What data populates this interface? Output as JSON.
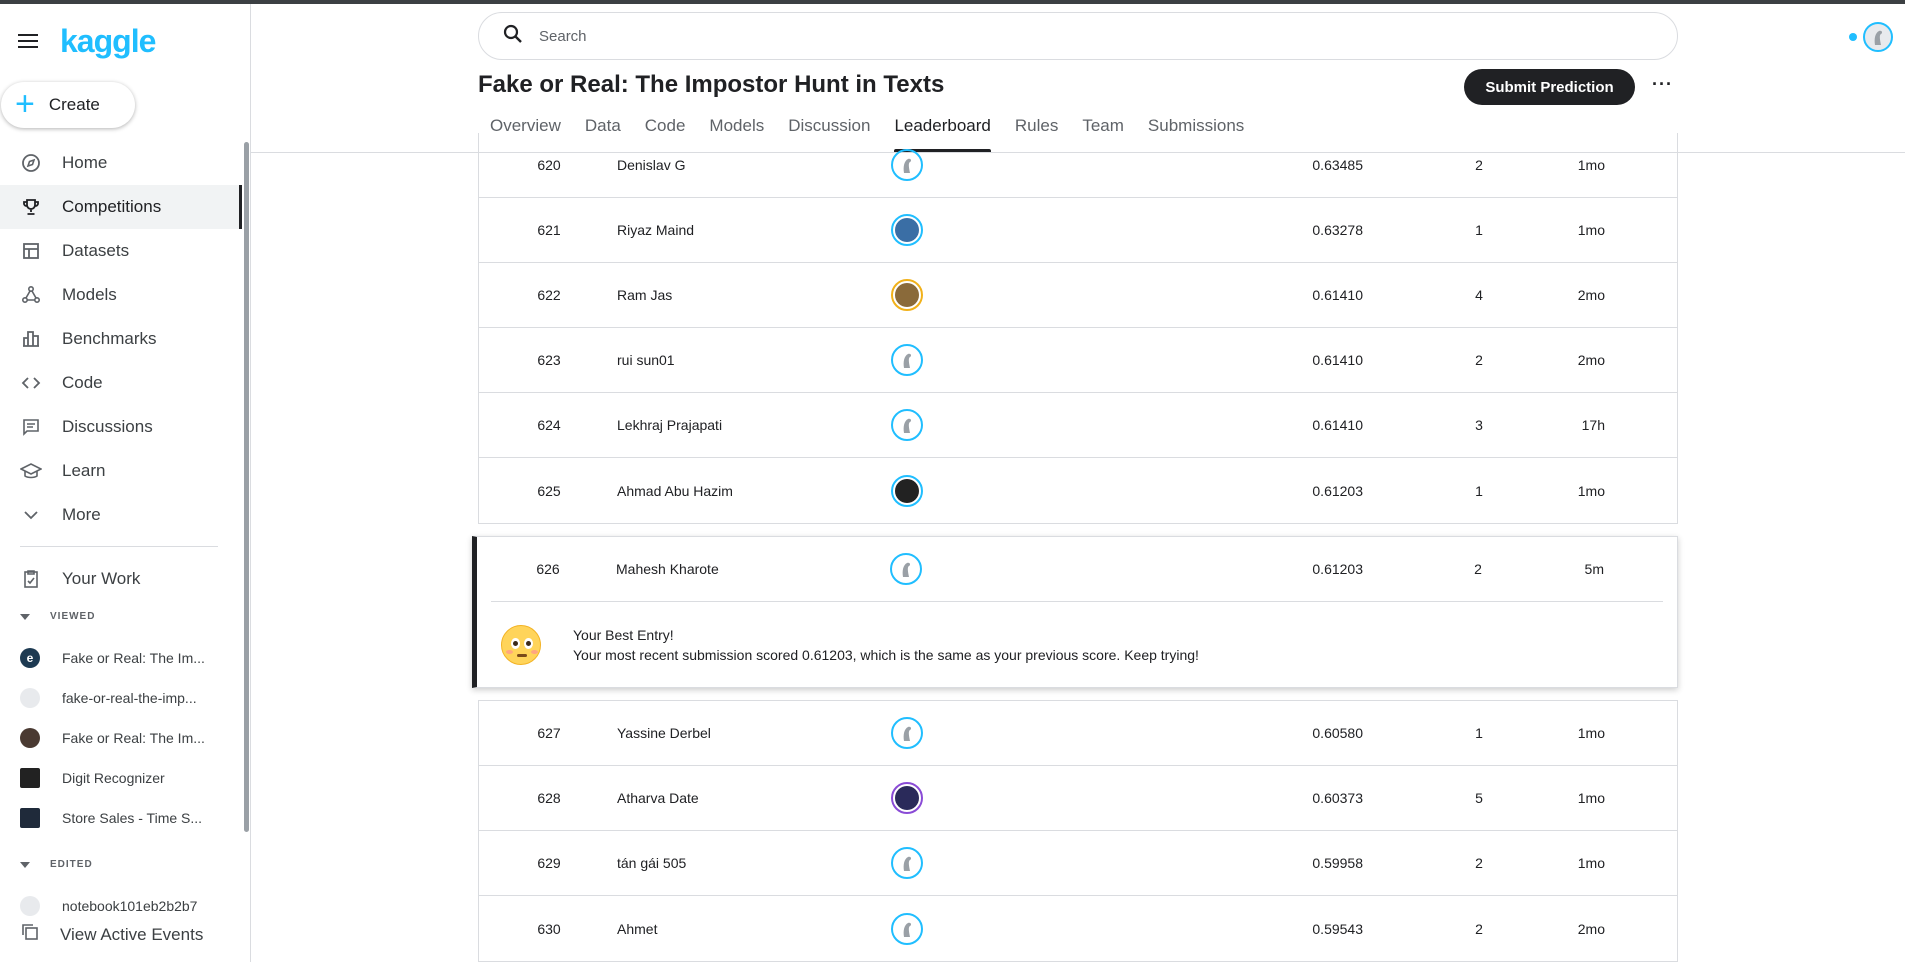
{
  "app": {
    "logo": "kaggle"
  },
  "sidebar": {
    "create_label": "Create",
    "nav": [
      {
        "label": "Home",
        "icon": "compass-icon"
      },
      {
        "label": "Competitions",
        "icon": "trophy-icon"
      },
      {
        "label": "Datasets",
        "icon": "table-icon"
      },
      {
        "label": "Models",
        "icon": "models-icon"
      },
      {
        "label": "Benchmarks",
        "icon": "bar-chart-icon"
      },
      {
        "label": "Code",
        "icon": "code-icon"
      },
      {
        "label": "Discussions",
        "icon": "chat-icon"
      },
      {
        "label": "Learn",
        "icon": "graduation-cap-icon"
      },
      {
        "label": "More",
        "icon": "chevron-down-icon"
      }
    ],
    "your_work": "Your Work",
    "viewed_label": "VIEWED",
    "viewed": [
      "Fake or Real: The Im...",
      "fake-or-real-the-imp...",
      "Fake or Real: The Im...",
      "Digit Recognizer",
      "Store Sales - Time S..."
    ],
    "edited_label": "EDITED",
    "edited": [
      "notebook101eb2b2b7"
    ],
    "view_events": "View Active Events"
  },
  "header": {
    "search_placeholder": "Search",
    "title": "Fake or Real: The Impostor Hunt in Texts",
    "submit_label": "Submit Prediction",
    "more_label": "···",
    "tabs": [
      "Overview",
      "Data",
      "Code",
      "Models",
      "Discussion",
      "Leaderboard",
      "Rules",
      "Team",
      "Submissions"
    ],
    "active_tab": "Leaderboard"
  },
  "leaderboard": {
    "rows_before": [
      {
        "rank": "620",
        "name": "Denislav G",
        "score": "0.63485",
        "entries": "2",
        "last": "1mo"
      },
      {
        "rank": "621",
        "name": "Riyaz Maind",
        "score": "0.63278",
        "entries": "1",
        "last": "1mo"
      },
      {
        "rank": "622",
        "name": "Ram Jas",
        "score": "0.61410",
        "entries": "4",
        "last": "2mo"
      },
      {
        "rank": "623",
        "name": "rui sun01",
        "score": "0.61410",
        "entries": "2",
        "last": "2mo"
      },
      {
        "rank": "624",
        "name": "Lekhraj Prajapati",
        "score": "0.61410",
        "entries": "3",
        "last": "17h"
      },
      {
        "rank": "625",
        "name": "Ahmad Abu Hazim",
        "score": "0.61203",
        "entries": "1",
        "last": "1mo"
      }
    ],
    "my_row": {
      "rank": "626",
      "name": "Mahesh Kharote",
      "score": "0.61203",
      "entries": "2",
      "last": "5m"
    },
    "best_entry_title": "Your Best Entry!",
    "best_entry_message": "Your most recent submission scored 0.61203, which is the same as your previous score. Keep trying!",
    "rows_after": [
      {
        "rank": "627",
        "name": "Yassine Derbel",
        "score": "0.60580",
        "entries": "1",
        "last": "1mo"
      },
      {
        "rank": "628",
        "name": "Atharva Date",
        "score": "0.60373",
        "entries": "5",
        "last": "1mo"
      },
      {
        "rank": "629",
        "name": "tán gái 505",
        "score": "0.59958",
        "entries": "2",
        "last": "1mo"
      },
      {
        "rank": "630",
        "name": "Ahmet",
        "score": "0.59543",
        "entries": "2",
        "last": "2mo"
      }
    ]
  },
  "colors": {
    "brand": "#20beff",
    "dark": "#202124",
    "border": "#dadce0"
  }
}
